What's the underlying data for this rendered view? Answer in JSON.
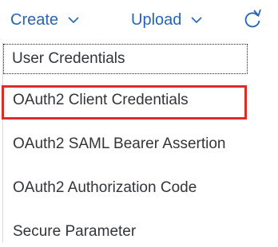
{
  "toolbar": {
    "create_label": "Create",
    "upload_label": "Upload",
    "link_color": "#2366b8"
  },
  "menu": {
    "items": [
      {
        "label": "User Credentials",
        "focused": true
      },
      {
        "label": "OAuth2 Client Credentials",
        "highlighted": true
      },
      {
        "label": "OAuth2 SAML Bearer Assertion"
      },
      {
        "label": "OAuth2 Authorization Code"
      },
      {
        "label": "Secure Parameter"
      }
    ],
    "highlight_color": "#e02b2b"
  },
  "icons": {
    "dropdown": "chevron-down-icon",
    "refresh": "refresh-icon"
  }
}
